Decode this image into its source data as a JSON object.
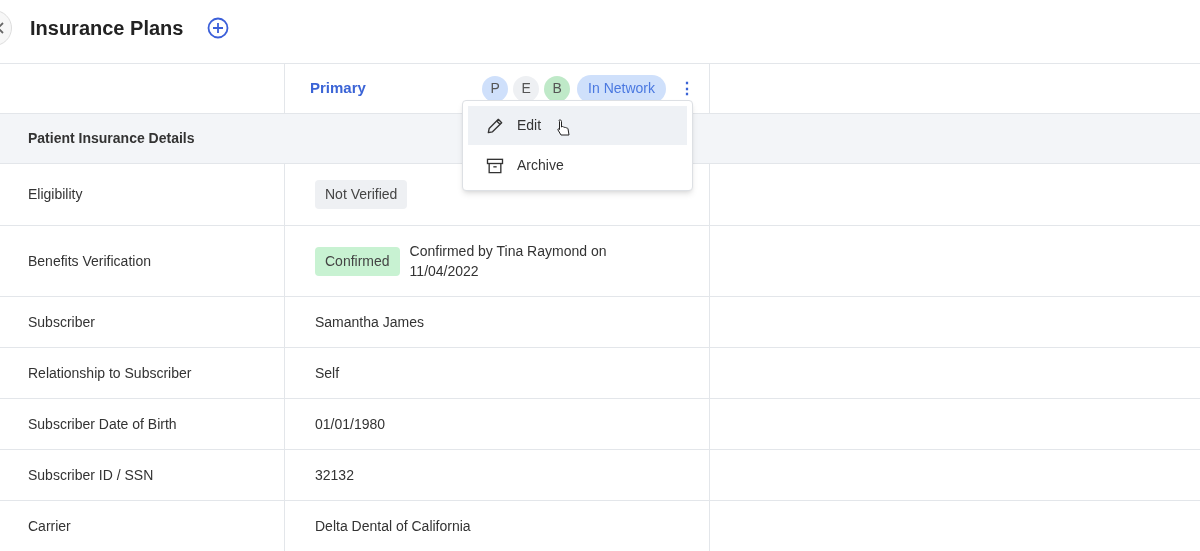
{
  "page": {
    "title": "Insurance Plans"
  },
  "plan": {
    "name": "Primary",
    "badges": [
      {
        "label": "P",
        "color": "#cfe0fb"
      },
      {
        "label": "E",
        "color": "#eef0f3"
      },
      {
        "label": "B",
        "color": "#bfe9c8"
      }
    ],
    "network": "In Network",
    "more": "⋮"
  },
  "menu": {
    "items": [
      {
        "label": "Edit",
        "kind": "edit",
        "selected": true
      },
      {
        "label": "Archive",
        "kind": "archive",
        "selected": false
      }
    ]
  },
  "section": "Patient Insurance Details",
  "rows": [
    {
      "label": "Eligibility",
      "kind": "tag",
      "tag": "Not Verified",
      "color": "#eef0f3"
    },
    {
      "label": "Benefits Verification",
      "kind": "tag",
      "tag": "Confirmed",
      "color": "#c8f2d2",
      "note": "Confirmed by Tina Raymond on 11/04/2022"
    },
    {
      "label": "Subscriber",
      "kind": "text",
      "value": "Samantha James"
    },
    {
      "label": "Relationship to Subscriber",
      "kind": "text",
      "value": "Self"
    },
    {
      "label": "Subscriber Date of Birth",
      "kind": "text",
      "value": "01/01/1980"
    },
    {
      "label": "Subscriber ID / SSN",
      "kind": "text",
      "value": "32132"
    },
    {
      "label": "Carrier",
      "kind": "text",
      "value": "Delta Dental of California"
    }
  ]
}
